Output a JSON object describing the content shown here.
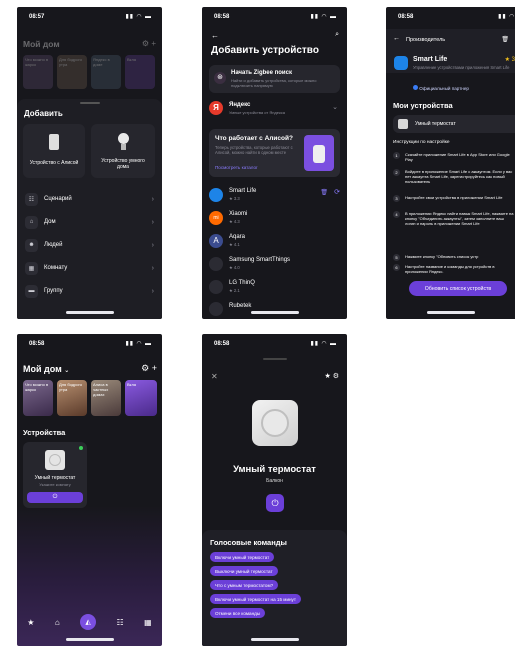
{
  "s1": {
    "time": "08:57",
    "home_title": "Мой дом",
    "stories": [
      "Что можно в жарко",
      "Для бодрого утра",
      "Яндекс в доме",
      "Вкла"
    ],
    "sheet_title": "Добавить",
    "tile1": "Устройство с Алисой",
    "tile2": "Устройство умного дома",
    "menu": [
      "Сценарий",
      "Дом",
      "Людей",
      "Комнату",
      "Группу"
    ]
  },
  "s2": {
    "time": "08:58",
    "title": "Добавить устройство",
    "zigbee_title": "Начать Zigbee поиск",
    "zigbee_sub": "Найти и добавить устройства, которые можно подключить напрямую",
    "yandex_title": "Яндекс",
    "yandex_sub": "Умные устройства от Яндекса",
    "promo_title": "Что работает с Алисой?",
    "promo_text": "Теперь устройства, которые работают с Алисой, можно найти в одном месте",
    "promo_link": "Посмотреть каталог",
    "vendors": [
      {
        "name": "Smart Life",
        "rating": "3.3"
      },
      {
        "name": "Xiaomi",
        "rating": "4.3"
      },
      {
        "name": "Aqara",
        "rating": "4.1"
      },
      {
        "name": "Samsung SmartThings",
        "rating": "4.0"
      },
      {
        "name": "LG ThinQ",
        "rating": "2.1"
      },
      {
        "name": "Rubetek",
        "rating": ""
      }
    ]
  },
  "s3": {
    "time": "08:58",
    "header": "Производитель",
    "app_name": "Smart Life",
    "rating": "3",
    "app_desc": "Управление устройствами приложения Smart Life",
    "partner": "Официальный партнер",
    "my_devices": "Мои устройства",
    "device": "Умный термостат",
    "instr_title": "Инструкции по настройке",
    "steps": [
      "Скачайте приложение Smart Life в App Store или Google Play",
      "Войдите в приложение Smart Life с аккаунтом. Если у вас нет аккаунта Smart Life, зарегистрируйтесь как новый пользователь",
      "Настройте свои устройства в приложении Smart Life",
      "В приложении Яндекс найти навык Smart Life, нажмите на кнопку \"Объединить аккаунты\", затем заполните ваш логин и пароль в приложении Smart Life",
      "Нажмите кнопку \"Обновить список устр",
      "Настройте название и команды для устройств в приложении Яндекс."
    ],
    "button": "Обновить список устройств"
  },
  "s4": {
    "time": "08:58",
    "home_title": "Мой дом",
    "stories": [
      "Что можно в жарко",
      "Для бодрого утра",
      "Алиса в частных домах",
      "Вкла"
    ],
    "section": "Устройства",
    "device": "Умный термостат",
    "device_sub": "Укажите комнату"
  },
  "s5": {
    "time": "08:58",
    "device": "Умный термостат",
    "room": "Балкон",
    "voice_title": "Голосовые команды",
    "commands": [
      "Включи умный термостат",
      "Выключи умный термостат",
      "Что с умным термостатом?",
      "Включи умный термостат на 15 минут",
      "Отмени все команды"
    ]
  },
  "colors": {
    "accent": "#6b3fd8",
    "bg": "#17171c",
    "card": "#26262d",
    "partner_blue": "#3a7cf5"
  }
}
